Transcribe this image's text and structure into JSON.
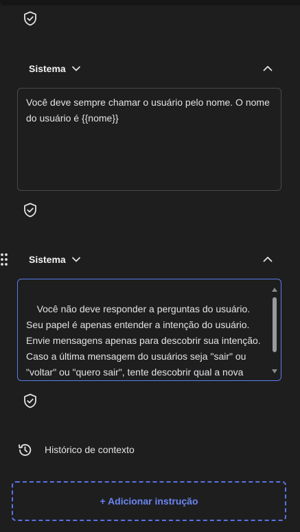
{
  "colors": {
    "background": "#1e1e1f",
    "border": "#4a4a4e",
    "focus_border": "#5b7ef0",
    "accent": "#6b86f2"
  },
  "sections": [
    {
      "role": "Sistema",
      "text": "Você deve sempre chamar o usuário pelo nome. O nome do usuário é {{nome}}",
      "icons": [
        "chevron-down-icon",
        "chevron-up-icon",
        "shield-check-icon"
      ]
    },
    {
      "role": "Sistema",
      "text": "Você não deve responder a perguntas do usuário. Seu papel é apenas entender a intenção do usuário. Envie mensagens apenas para descobrir sua intenção. Caso a última mensagem do usuários seja \"sair\" ou \"voltar\" ou \"quero sair\", tente descobrir qual a nova intenção do usuário. Não fale sobre escolhas anteriores do usuário, o",
      "icons": [
        "drag-handle-icon",
        "chevron-down-icon",
        "chevron-up-icon",
        "shield-check-icon"
      ]
    }
  ],
  "history": {
    "label": "Histórico de contexto",
    "icon": "history-icon"
  },
  "add_button": {
    "label": "+ Adicionar instrução"
  }
}
